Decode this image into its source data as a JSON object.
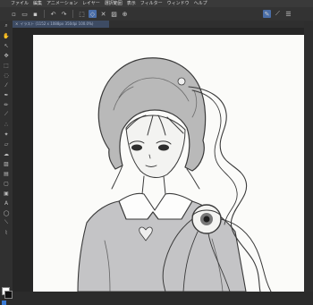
{
  "menu": {
    "items": [
      "ファイル",
      "編集",
      "アニメーション",
      "レイヤー",
      "選択範囲",
      "表示",
      "フィルター",
      "ウィンドウ",
      "ヘルプ"
    ]
  },
  "document": {
    "tab_label": "イラスト (1152 x 1088px 350dpi 100.0%)",
    "close_glyph": "×"
  },
  "toolbar": {
    "icons": [
      "new-icon",
      "open-icon",
      "save-icon",
      "undo-icon",
      "redo-icon",
      "transform-icon",
      "selection-icon",
      "clear-icon",
      "fill-icon",
      "zoom-icon",
      "pen-icon",
      "brush-icon",
      "menu-icon"
    ]
  },
  "tools": {
    "icons": [
      "zoom-icon",
      "hand-icon",
      "operation-icon",
      "move-icon",
      "select-icon",
      "lasso-icon",
      "eyedropper-icon",
      "pen-icon",
      "pencil-icon",
      "brush-icon",
      "airbrush-icon",
      "decoration-icon",
      "eraser-icon",
      "blend-icon",
      "fill-icon",
      "gradient-icon",
      "figure-icon",
      "frame-icon",
      "text-icon",
      "balloon-icon",
      "ruler-icon",
      "correct-line-icon"
    ]
  },
  "colors": {
    "background": "#2b2b2b",
    "accent": "#4a6ea8",
    "canvas": "#fbfbf9",
    "sketch": "#3a3a3a"
  }
}
